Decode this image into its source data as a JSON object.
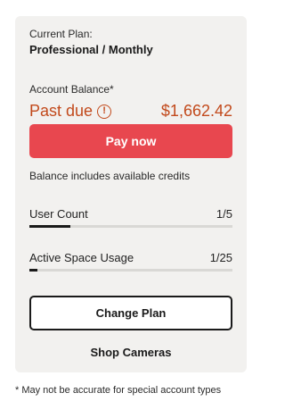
{
  "plan": {
    "current_label": "Current Plan:",
    "name": "Professional / Monthly"
  },
  "balance": {
    "label": "Account Balance*",
    "status": "Past due",
    "status_icon": "alert-circle-icon",
    "status_icon_glyph": "!",
    "amount": "$1,662.42",
    "status_color": "#c24a1c"
  },
  "actions": {
    "pay_label": "Pay now",
    "pay_color": "#e8474f",
    "change_plan_label": "Change Plan",
    "shop_label": "Shop Cameras"
  },
  "credits_note": "Balance includes available credits",
  "usage": [
    {
      "label": "User Count",
      "value": "1/5",
      "fraction": 0.2
    },
    {
      "label": "Active Space Usage",
      "value": "1/25",
      "fraction": 0.04
    }
  ],
  "footnote": "* May not be accurate for special account types"
}
